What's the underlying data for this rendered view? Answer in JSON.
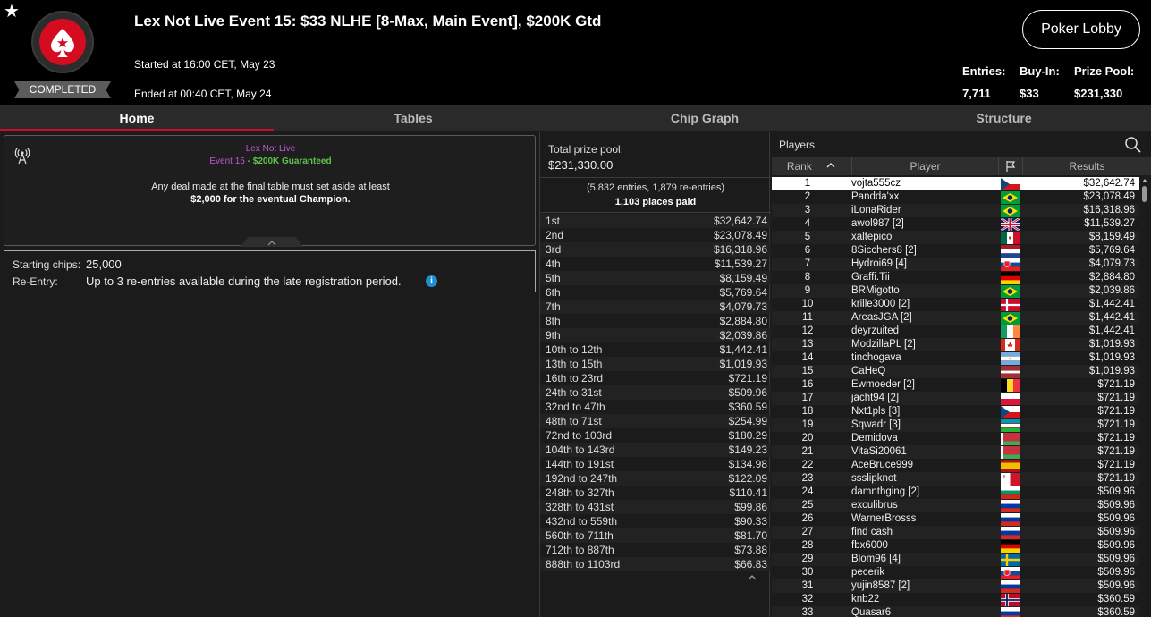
{
  "header": {
    "title": "Lex Not Live Event 15: $33 NLHE [8-Max, Main Event], $200K Gtd",
    "badge": "COMPLETED",
    "started": "Started at 16:00 CET, May 23",
    "ended": "Ended at 00:40 CET, May 24",
    "lobby_button": "Poker Lobby",
    "entries_label": "Entries:",
    "entries_value": "7,711",
    "buyin_label": "Buy-In:",
    "buyin_value": "$33",
    "prizepool_label": "Prize Pool:",
    "prizepool_value": "$231,330"
  },
  "tabs": [
    "Home",
    "Tables",
    "Chip Graph",
    "Structure"
  ],
  "notice": {
    "line1": "Lex Not Live",
    "event": "Event 15",
    "dash": " - ",
    "guaranteed": "$200K Guaranteed",
    "line3": "Any deal made at the final table must set aside at least",
    "line4": "$2,000 for the eventual Champion."
  },
  "info": {
    "chips_label": "Starting chips:",
    "chips_value": "25,000",
    "reentry_label": "Re-Entry:",
    "reentry_value": "Up to 3 re-entries available during the late registration period."
  },
  "prize": {
    "total_label": "Total prize pool:",
    "total_value": "$231,330.00",
    "entries_note": "(5,832 entries, 1,879 re-entries)",
    "places_paid": "1,103 places paid",
    "payouts": [
      [
        "1st",
        "$32,642.74"
      ],
      [
        "2nd",
        "$23,078.49"
      ],
      [
        "3rd",
        "$16,318.96"
      ],
      [
        "4th",
        "$11,539.27"
      ],
      [
        "5th",
        "$8,159.49"
      ],
      [
        "6th",
        "$5,769.64"
      ],
      [
        "7th",
        "$4,079.73"
      ],
      [
        "8th",
        "$2,884.80"
      ],
      [
        "9th",
        "$2,039.86"
      ],
      [
        "10th to 12th",
        "$1,442.41"
      ],
      [
        "13th to 15th",
        "$1,019.93"
      ],
      [
        "16th to 23rd",
        "$721.19"
      ],
      [
        "24th to 31st",
        "$509.96"
      ],
      [
        "32nd to 47th",
        "$360.59"
      ],
      [
        "48th to 71st",
        "$254.99"
      ],
      [
        "72nd to 103rd",
        "$180.29"
      ],
      [
        "104th to 143rd",
        "$149.23"
      ],
      [
        "144th to 191st",
        "$134.98"
      ],
      [
        "192nd to 247th",
        "$122.09"
      ],
      [
        "248th to 327th",
        "$110.41"
      ],
      [
        "328th to 431st",
        "$99.86"
      ],
      [
        "432nd to 559th",
        "$90.33"
      ],
      [
        "560th to 711th",
        "$81.70"
      ],
      [
        "712th to 887th",
        "$73.88"
      ],
      [
        "888th to 1103rd",
        "$66.83"
      ]
    ]
  },
  "players": {
    "title": "Players",
    "col_rank": "Rank",
    "col_player": "Player",
    "col_results": "Results",
    "rows": [
      {
        "rank": "1",
        "name": "vojta555cz",
        "flag": "cz",
        "result": "$32,642.74"
      },
      {
        "rank": "2",
        "name": "Pandda'xx",
        "flag": "br",
        "result": "$23,078.49"
      },
      {
        "rank": "3",
        "name": "iLonaRider",
        "flag": "br",
        "result": "$16,318.96"
      },
      {
        "rank": "4",
        "name": "awol987 [2]",
        "flag": "gb",
        "result": "$11,539.27"
      },
      {
        "rank": "5",
        "name": "xaltepico",
        "flag": "mx",
        "result": "$8,159.49"
      },
      {
        "rank": "6",
        "name": "8Sicchers8 [2]",
        "flag": "nl",
        "result": "$5,769.64"
      },
      {
        "rank": "7",
        "name": "Hydroi69 [4]",
        "flag": "sk",
        "result": "$4,079.73"
      },
      {
        "rank": "8",
        "name": "Graffi.Tii",
        "flag": "de",
        "result": "$2,884.80"
      },
      {
        "rank": "9",
        "name": "BRMigotto",
        "flag": "br",
        "result": "$2,039.86"
      },
      {
        "rank": "10",
        "name": "krille3000 [2]",
        "flag": "dk",
        "result": "$1,442.41"
      },
      {
        "rank": "11",
        "name": "AreasJGA [2]",
        "flag": "br",
        "result": "$1,442.41"
      },
      {
        "rank": "12",
        "name": "deyrzuited",
        "flag": "ie",
        "result": "$1,442.41"
      },
      {
        "rank": "13",
        "name": "ModzillaPL [2]",
        "flag": "ca",
        "result": "$1,019.93"
      },
      {
        "rank": "14",
        "name": "tinchogava",
        "flag": "ar",
        "result": "$1,019.93"
      },
      {
        "rank": "15",
        "name": "CaHeQ",
        "flag": "lv",
        "result": "$1,019.93"
      },
      {
        "rank": "16",
        "name": "Ewmoeder [2]",
        "flag": "be",
        "result": "$721.19"
      },
      {
        "rank": "17",
        "name": "jacht94 [2]",
        "flag": "pl",
        "result": "$721.19"
      },
      {
        "rank": "18",
        "name": "Nxt1pls [3]",
        "flag": "cz",
        "result": "$721.19"
      },
      {
        "rank": "19",
        "name": "Sqwadr [3]",
        "flag": "uz",
        "result": "$721.19"
      },
      {
        "rank": "20",
        "name": "Demidova",
        "flag": "by",
        "result": "$721.19"
      },
      {
        "rank": "21",
        "name": "VitaSi20061",
        "flag": "by",
        "result": "$721.19"
      },
      {
        "rank": "22",
        "name": "AceBruce999",
        "flag": "es",
        "result": "$721.19"
      },
      {
        "rank": "23",
        "name": "ssslipknot",
        "flag": "mt",
        "result": "$721.19"
      },
      {
        "rank": "24",
        "name": "damnthging [2]",
        "flag": "bg",
        "result": "$509.96"
      },
      {
        "rank": "25",
        "name": "exculibrus",
        "flag": "ru",
        "result": "$509.96"
      },
      {
        "rank": "26",
        "name": "WarnerBrosss",
        "flag": "ru",
        "result": "$509.96"
      },
      {
        "rank": "27",
        "name": "find cash",
        "flag": "ru",
        "result": "$509.96"
      },
      {
        "rank": "28",
        "name": "fbx6000",
        "flag": "de",
        "result": "$509.96"
      },
      {
        "rank": "29",
        "name": "Blom96 [4]",
        "flag": "se",
        "result": "$509.96"
      },
      {
        "rank": "30",
        "name": "pecerik",
        "flag": "sk",
        "result": "$509.96"
      },
      {
        "rank": "31",
        "name": "yujin8587 [2]",
        "flag": "ru",
        "result": "$509.96"
      },
      {
        "rank": "32",
        "name": "knb22",
        "flag": "no",
        "result": "$360.59"
      },
      {
        "rank": "33",
        "name": "Quasar6",
        "flag": "ru",
        "result": "$360.59"
      }
    ]
  },
  "colors": {
    "accent": "#c8102e",
    "event_purple": "#c157d4",
    "guaranteed_green": "#5fc24a",
    "info_blue": "#1e8fcf"
  }
}
